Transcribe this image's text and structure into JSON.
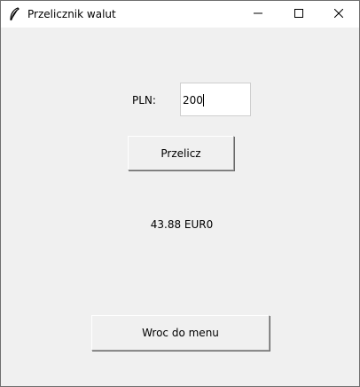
{
  "window": {
    "title": "Przelicznik walut",
    "controls": {
      "minimize_icon": "minimize-icon",
      "maximize_icon": "maximize-icon",
      "close_icon": "close-icon"
    }
  },
  "form": {
    "pln_label": "PLN:",
    "pln_value": "200",
    "convert_button": "Przelicz",
    "result": "43.88 EUR0",
    "back_button": "Wroc do menu"
  },
  "colors": {
    "window_bg": "#f0f0f0",
    "titlebar_bg": "#ffffff",
    "input_bg": "#ffffff"
  }
}
